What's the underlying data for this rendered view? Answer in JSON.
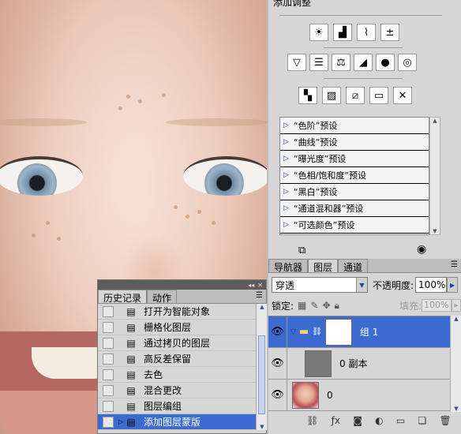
{
  "adjustments": {
    "title": "添加调整",
    "row1_icons": [
      "brightness-icon",
      "levels-icon",
      "curves-icon",
      "exposure-icon"
    ],
    "row2_icons": [
      "vibrance-icon",
      "hue-saturation-icon",
      "color-balance-icon",
      "black-white-icon",
      "photo-filter-icon",
      "channel-mixer-icon"
    ],
    "row3_icons": [
      "invert-icon",
      "posterize-icon",
      "threshold-icon",
      "gradient-map-icon",
      "selective-color-icon"
    ],
    "presets": [
      "“色阶”预设",
      "“曲线”预设",
      "“曝光度”预设",
      "“色相/饱和度”预设",
      "“黑白”预设",
      "“通道混和器”预设",
      "“可选颜色”预设"
    ]
  },
  "history": {
    "tabs": [
      "历史记录",
      "动作"
    ],
    "items": [
      "打开为智能对象",
      "栅格化图层",
      "通过拷贝的图层",
      "高反差保留",
      "去色",
      "混合更改",
      "图层编组",
      "添加图层蒙版"
    ],
    "selected_index": 7
  },
  "layers": {
    "tabs": [
      "导航器",
      "图层",
      "通道"
    ],
    "blend_mode": "穿透",
    "opacity_label": "不透明度:",
    "opacity_value": "100%",
    "lock_label": "锁定:",
    "fill_label": "填充:",
    "fill_value": "100%",
    "items": [
      {
        "name": "组 1",
        "selected": true
      },
      {
        "name": "0 副本",
        "selected": false
      },
      {
        "name": "0",
        "selected": false
      }
    ]
  },
  "colors": {
    "selection": "#3c6bd0",
    "panel_bg": "#d6d6d6"
  }
}
